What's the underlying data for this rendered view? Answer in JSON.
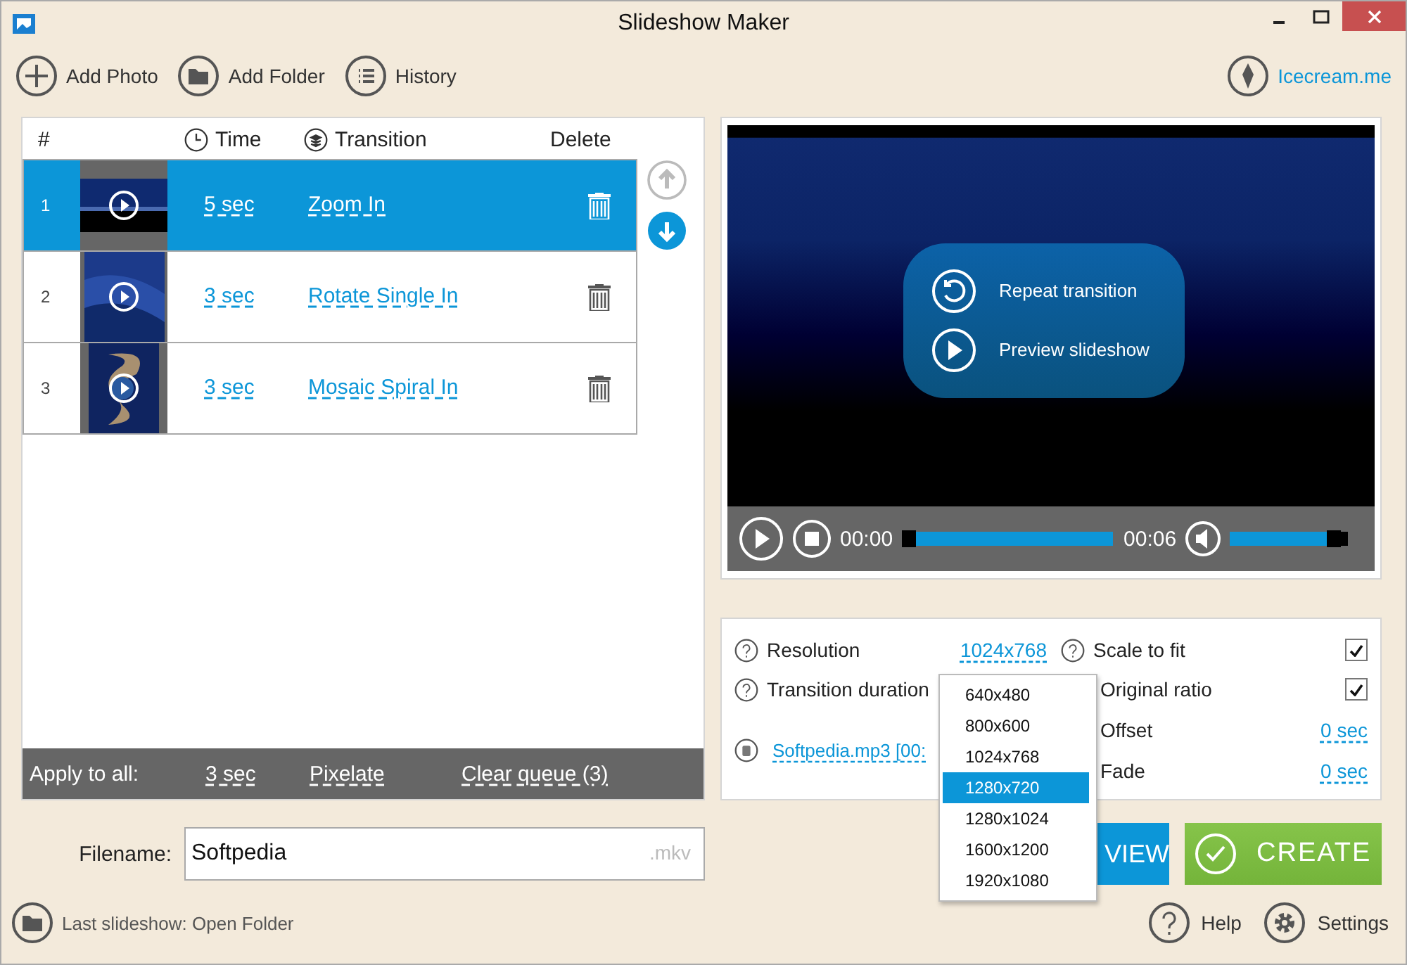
{
  "window": {
    "title": "Slideshow Maker"
  },
  "toolbar": [
    {
      "label": "Add Photo"
    },
    {
      "label": "Add Folder"
    },
    {
      "label": "History"
    }
  ],
  "site_link": "Icecream.me",
  "table": {
    "columns": [
      "#",
      "Time",
      "Transition",
      "Delete"
    ],
    "rows": [
      {
        "number": "1",
        "time": "5 sec",
        "transition": "Zoom In",
        "selected": true
      },
      {
        "number": "2",
        "time": "3 sec",
        "transition": "Rotate Single In",
        "selected": false
      },
      {
        "number": "3",
        "time": "3 sec",
        "transition": "Mosaic Spiral In",
        "selected": false
      }
    ]
  },
  "move_buttons": [
    {
      "disabled": true
    },
    {
      "disabled": false
    }
  ],
  "apply_bar": {
    "label": "Apply to all:",
    "time": "3 sec",
    "transition": "Pixelate",
    "clear": "Clear queue (3)"
  },
  "filename": {
    "label": "Filename:",
    "value": "Softpedia",
    "extension": ".mkv"
  },
  "preview": {
    "overlay": [
      "Repeat transition",
      "Preview slideshow"
    ],
    "current_time": "00:00",
    "total_time": "00:06",
    "seek": {
      "level": 0
    },
    "volume": {
      "level": 0.93
    }
  },
  "settings": {
    "left": [
      {
        "label": "Resolution",
        "value": "1024x768"
      },
      {
        "label": "Transition duration"
      }
    ],
    "audio": "Softpedia.mp3 [00:",
    "right": [
      {
        "label": "Scale to fit",
        "kind": "checkbox",
        "checked": true,
        "help": true
      },
      {
        "label": "Original ratio",
        "kind": "checkbox",
        "checked": true,
        "help": false
      },
      {
        "label": "Offset",
        "kind": "link",
        "value": "0 sec",
        "help": false
      },
      {
        "label": "Fade",
        "kind": "link",
        "value": "0 sec",
        "help": false
      }
    ]
  },
  "dropdown": {
    "options": [
      {
        "label": "640x480",
        "selected": false
      },
      {
        "label": "800x600",
        "selected": false
      },
      {
        "label": "1024x768",
        "selected": false
      },
      {
        "label": "1280x720",
        "selected": true
      },
      {
        "label": "1280x1024",
        "selected": false
      },
      {
        "label": "1600x1200",
        "selected": false
      },
      {
        "label": "1920x1080",
        "selected": false
      }
    ]
  },
  "buttons": {
    "preview": "VIEW",
    "create": "CREATE"
  },
  "status": {
    "text": "Last slideshow: Open Folder",
    "help": "Help",
    "settings": "Settings"
  }
}
